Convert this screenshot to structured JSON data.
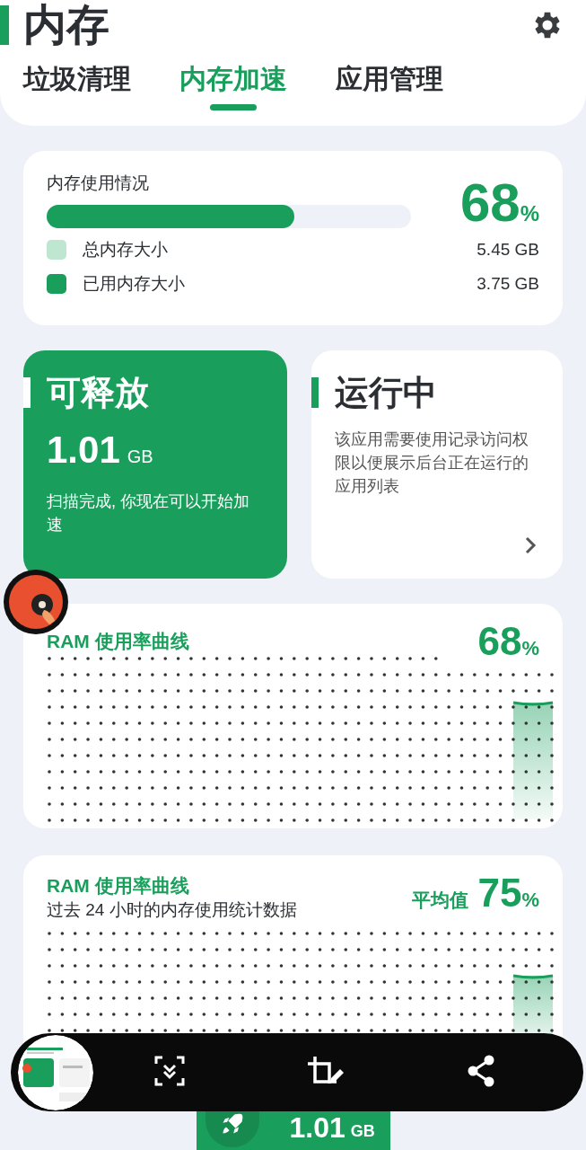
{
  "header": {
    "title": "内存",
    "tabs": [
      {
        "label": "垃圾清理",
        "selected": false
      },
      {
        "label": "内存加速",
        "selected": true
      },
      {
        "label": "应用管理",
        "selected": false
      }
    ]
  },
  "memory_usage": {
    "label": "内存使用情况",
    "level": 0.68,
    "percent": "68",
    "unit": "%",
    "legend": [
      {
        "label": "总内存大小",
        "value": "5.45 GB",
        "color": "#bfe6d0"
      },
      {
        "label": "已用内存大小",
        "value": "3.75 GB",
        "color": "#1a9e5c"
      }
    ]
  },
  "releasable": {
    "title": "可释放",
    "amount": "1.01",
    "unit": "GB",
    "message": "扫描完成, 你现在可以开始加速"
  },
  "running": {
    "title": "运行中",
    "message": "该应用需要使用记录访问权限以便展示后台正在运行的应用列表"
  },
  "ram_chart": {
    "title": "RAM 使用率曲线",
    "percent": "68",
    "unit": "%"
  },
  "ram_history": {
    "title": "RAM 使用率曲线",
    "subtitle": "过去 24 小时的内存使用统计数据",
    "avg_label": "平均值",
    "percent": "75",
    "unit": "%"
  },
  "boost_button": {
    "amount": "1.01",
    "unit": "GB"
  }
}
